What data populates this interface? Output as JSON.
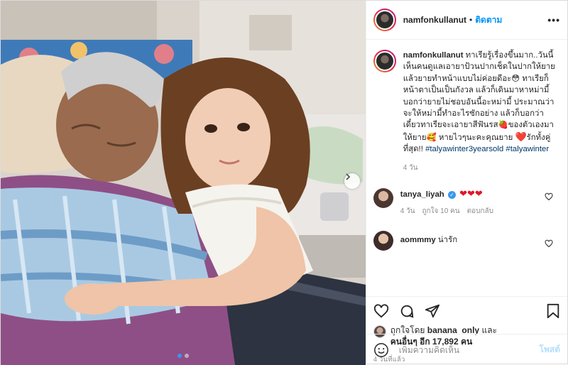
{
  "post": {
    "username": "namfonkullanut",
    "follow_label": "ติดตาม",
    "separator": "•",
    "more_label": "•••"
  },
  "caption": {
    "username": "namfonkullanut",
    "text_1": "ทาเรียรู้เรื่องขึ้นมาก..วันนี้เห็นคนดูแลเอายาป้วนปากเช็ดในปากให้ยาย แล้วยายทำหน้าแบบไม่ค่อยดีอะ",
    "emoji_1": "😳",
    "text_2": "ทาเรียก็หน้าตาเป็นเป็นกังวล แล้วก็เดินมาหาหม่ามี้บอกว่ายายไม่ชอบอันนี้อะหม่ามี้ ประมาณว่าจะให้หม่ามี้ทำอะไรซักอย่าง แล้วก็บอกว่าเดี๋ยวทาเรียจะเอายาสีฟันรส",
    "emoji_2": "🍓",
    "text_3": "ของตัวเองมาให้ยาย",
    "emoji_3": "🥰",
    "text_4": " หายไวๆนะคะคุณยาย",
    "emoji_4": "❤️",
    "text_5": "รักทั้งคู่ที่สุด!!",
    "hashtag_1": "#talyawinter3yearsold",
    "hashtag_2": "#talyawinter",
    "time": "4 วัน"
  },
  "comments": [
    {
      "username": "tanya_liyah",
      "verified_mark": "✓",
      "text": "❤❤❤",
      "time": "4 วัน",
      "likes": "ถูกใจ 10 คน",
      "reply": "ตอบกลับ"
    },
    {
      "username": "aommmy",
      "text": "น่ารัก"
    }
  ],
  "likes": {
    "prefix": "ถูกใจโดย",
    "user": "banana_only",
    "conj": "และ",
    "others": "คนอื่นๆ อีก 17,892 คน"
  },
  "posted_time": "4 วันที่แล้ว",
  "add_comment": {
    "placeholder": "เพิ่มความคิดเห็น",
    "post_label": "โพสต์"
  },
  "colors": {
    "accent": "#0095f6",
    "heart": "#e0162b",
    "hashtag": "#00376b"
  },
  "carousel": {
    "total": 2,
    "current": 1
  }
}
